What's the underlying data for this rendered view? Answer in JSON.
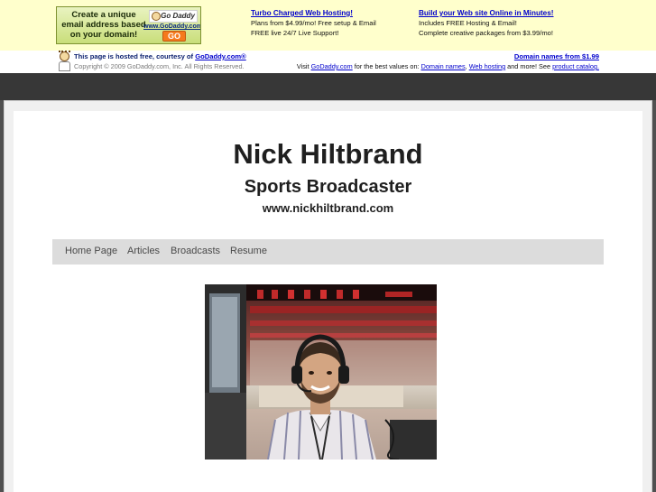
{
  "ad_bar": {
    "image_ad": {
      "line1": "Create a unique",
      "line2": "email address based",
      "line3": "on your domain!",
      "logo_text": "Go Daddy",
      "url_text": "www.GoDaddy.com",
      "go_label": "GO"
    },
    "ad1": {
      "title": "Turbo Charged Web Hosting!",
      "line1": "Plans from $4.99/mo! Free setup & Email",
      "line2": "FREE live 24/7 Live Support!"
    },
    "ad2": {
      "title": "Build your Web site Online in Minutes!",
      "line1": "Includes FREE Hosting & Email!",
      "line2": "Complete creative packages from $3.99/mo!"
    }
  },
  "notice_bar": {
    "hosted_prefix": "This page is hosted free, courtesy of ",
    "hosted_link": "GoDaddy.com®",
    "copyright": "Copyright © 2009 GoDaddy.com, Inc. All Rights Reserved.",
    "domain_offer": "Domain names from $1.99",
    "visit_prefix": "Visit ",
    "visit_link": "GoDaddy.com",
    "visit_mid": " for the best values on: ",
    "link_domains": "Domain names",
    "sep": ", ",
    "link_hosting": "Web hosting",
    "visit_and": " and more! See ",
    "link_catalog": "product catalog."
  },
  "site": {
    "title": "Nick Hiltbrand",
    "subtitle": "Sports Broadcaster",
    "url": "www.nickhiltbrand.com"
  },
  "nav": {
    "items": [
      {
        "label": "Home Page"
      },
      {
        "label": "Articles"
      },
      {
        "label": "Broadcasts"
      },
      {
        "label": "Resume"
      }
    ]
  },
  "colors": {
    "banner_bg": "#ffffcc",
    "link": "#0000cc",
    "dark_band": "#373737",
    "nav_bg": "#dcdcdc",
    "page_bg": "#ffffff",
    "frame_bg": "#505050"
  }
}
